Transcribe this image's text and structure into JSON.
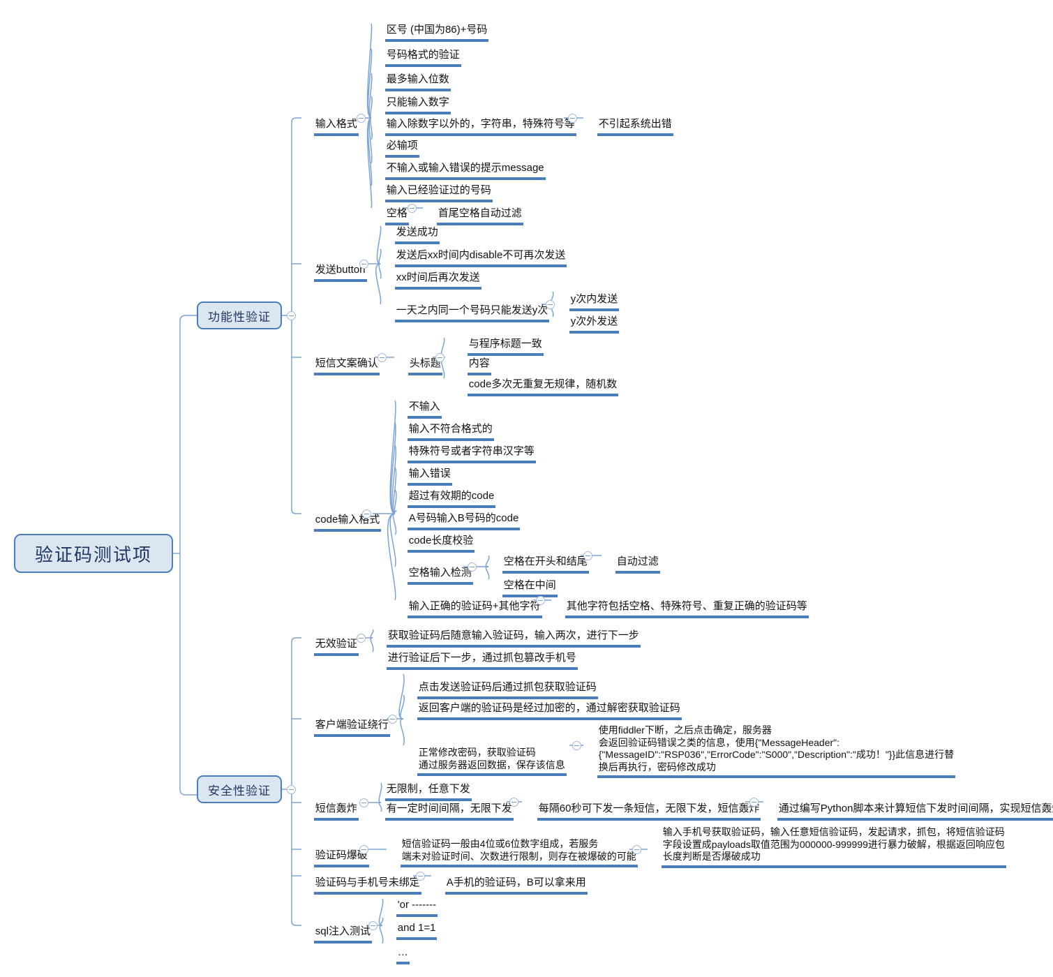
{
  "theme": {
    "accent": "#4a7ebb",
    "node_fill": "#dce6f1",
    "node_text": "#1f3864",
    "body_text": "#111111",
    "background": "#ffffff",
    "toggle_border": "#9db8dc"
  },
  "map": {
    "title": "验证码测试项",
    "type": "mindmap",
    "root": {
      "label": "验证码测试项",
      "children": [
        {
          "label": "功能性验证",
          "children": [
            {
              "label": "输入格式",
              "children": [
                {
                  "label": "区号 (中国为86)+号码"
                },
                {
                  "label": "号码格式的验证"
                },
                {
                  "label": "最多输入位数"
                },
                {
                  "label": "只能输入数字"
                },
                {
                  "label": "输入除数字以外的，字符串，特殊符号等",
                  "children": [
                    {
                      "label": "不引起系统出错"
                    }
                  ]
                },
                {
                  "label": "必输项"
                },
                {
                  "label": "不输入或输入错误的提示message"
                },
                {
                  "label": "输入已经验证过的号码"
                },
                {
                  "label": "空格",
                  "children": [
                    {
                      "label": "首尾空格自动过滤"
                    }
                  ]
                }
              ]
            },
            {
              "label": "发送button",
              "children": [
                {
                  "label": "发送成功"
                },
                {
                  "label": "发送后xx时间内disable不可再次发送"
                },
                {
                  "label": "xx时间后再次发送"
                },
                {
                  "label": "一天之内同一个号码只能发送y次",
                  "children": [
                    {
                      "label": "y次内发送"
                    },
                    {
                      "label": "y次外发送"
                    }
                  ]
                }
              ]
            },
            {
              "label": "短信文案确认",
              "children": [
                {
                  "label": "头标题",
                  "children": [
                    {
                      "label": "与程序标题一致"
                    },
                    {
                      "label": "内容"
                    },
                    {
                      "label": "code多次无重复无规律，随机数"
                    }
                  ]
                }
              ]
            },
            {
              "label": "code输入格式",
              "children": [
                {
                  "label": "不输入"
                },
                {
                  "label": "输入不符合格式的"
                },
                {
                  "label": "特殊符号或者字符串汉字等"
                },
                {
                  "label": "输入错误"
                },
                {
                  "label": "超过有效期的code"
                },
                {
                  "label": "A号码输入B号码的code"
                },
                {
                  "label": "code长度校验"
                },
                {
                  "label": "空格输入检测",
                  "children": [
                    {
                      "label": "空格在开头和结尾",
                      "children": [
                        {
                          "label": "自动过滤"
                        }
                      ]
                    },
                    {
                      "label": "空格在中间"
                    }
                  ]
                },
                {
                  "label": "输入正确的验证码+其他字符",
                  "children": [
                    {
                      "label": "其他字符包括空格、特殊符号、重复正确的验证码等"
                    }
                  ]
                }
              ]
            }
          ]
        },
        {
          "label": "安全性验证",
          "children": [
            {
              "label": "无效验证",
              "children": [
                {
                  "label": "获取验证码后随意输入验证码，输入两次，进行下一步"
                },
                {
                  "label": "进行验证后下一步，通过抓包篡改手机号"
                }
              ]
            },
            {
              "label": "客户端验证绕行",
              "children": [
                {
                  "label": "点击发送验证码后通过抓包获取验证码"
                },
                {
                  "label": "返回客户端的验证码是经过加密的，通过解密获取验证码"
                },
                {
                  "label": "正常修改密码，获取验证码\n通过服务器返回数据，保存该信息",
                  "children": [
                    {
                      "label": "使用fiddler下断，之后点击确定，服务器\n会返回验证码错误之类的信息，使用{\"MessageHeader\":\n{\"MessageID\":\"RSP036\",\"ErrorCode\":\"S000\",\"Description\":\"成功！\"}}此信息进行替\n换后再执行，密码修改成功"
                    }
                  ]
                }
              ]
            },
            {
              "label": "短信轰炸",
              "children": [
                {
                  "label": "无限制，任意下发"
                },
                {
                  "label": "有一定时间间隔，无限下发",
                  "children": [
                    {
                      "label": "每隔60秒可下发一条短信，无限下发，短信轰炸",
                      "children": [
                        {
                          "label": "通过编写Python脚本来计算短信下发时间间隔，实现短信轰炸"
                        }
                      ]
                    }
                  ]
                }
              ]
            },
            {
              "label": "验证码爆破",
              "children": [
                {
                  "label": "短信验证码一般由4位或6位数字组成，若服务\n端未对验证时间、次数进行限制，则存在被爆破的可能",
                  "children": [
                    {
                      "label": "输入手机号获取验证码，输入任意短信验证码，发起请求，抓包，将短信验证码\n字段设置成payloads取值范围为000000-999999进行暴力破解，根据返回响应包\n长度判断是否爆破成功"
                    }
                  ]
                }
              ]
            },
            {
              "label": "验证码与手机号未绑定",
              "children": [
                {
                  "label": "A手机的验证码，B可以拿来用"
                }
              ]
            },
            {
              "label": "sql注入测试",
              "children": [
                {
                  "label": "'or -------"
                },
                {
                  "label": "and 1=1"
                },
                {
                  "label": "…"
                }
              ]
            }
          ]
        }
      ]
    }
  },
  "nodes": {
    "root": "验证码测试项",
    "b1": "功能性验证",
    "b2": "安全性验证",
    "n_input_format": "输入格式",
    "n_if_1": "区号 (中国为86)+号码",
    "n_if_2": "号码格式的验证",
    "n_if_3": "最多输入位数",
    "n_if_4": "只能输入数字",
    "n_if_5": "输入除数字以外的，字符串，特殊符号等",
    "n_if_5_1": "不引起系统出错",
    "n_if_6": "必输项",
    "n_if_7": "不输入或输入错误的提示message",
    "n_if_8": "输入已经验证过的号码",
    "n_if_9": "空格",
    "n_if_9_1": "首尾空格自动过滤",
    "n_send_btn": "发送button",
    "n_sb_1": "发送成功",
    "n_sb_2": "发送后xx时间内disable不可再次发送",
    "n_sb_3": "xx时间后再次发送",
    "n_sb_4": "一天之内同一个号码只能发送y次",
    "n_sb_4_1": "y次内发送",
    "n_sb_4_2": "y次外发送",
    "n_sms_text": "短信文案确认",
    "n_st_1": "头标题",
    "n_st_1_1": "与程序标题一致",
    "n_st_1_2": "内容",
    "n_st_1_3": "code多次无重复无规律，随机数",
    "n_code_format": "code输入格式",
    "n_cf_1": "不输入",
    "n_cf_2": "输入不符合格式的",
    "n_cf_3": "特殊符号或者字符串汉字等",
    "n_cf_4": "输入错误",
    "n_cf_5": "超过有效期的code",
    "n_cf_6": "A号码输入B号码的code",
    "n_cf_7": "code长度校验",
    "n_cf_8": "空格输入检测",
    "n_cf_8_1": "空格在开头和结尾",
    "n_cf_8_1_1": "自动过滤",
    "n_cf_8_2": "空格在中间",
    "n_cf_9": "输入正确的验证码+其他字符",
    "n_cf_9_1": "其他字符包括空格、特殊符号、重复正确的验证码等",
    "n_invalid": "无效验证",
    "n_iv_1": "获取验证码后随意输入验证码，输入两次，进行下一步",
    "n_iv_2": "进行验证后下一步，通过抓包篡改手机号",
    "n_bypass": "客户端验证绕行",
    "n_bp_1": "点击发送验证码后通过抓包获取验证码",
    "n_bp_2": "返回客户端的验证码是经过加密的，通过解密获取验证码",
    "n_bp_3": "正常修改密码，获取验证码\n通过服务器返回数据，保存该信息",
    "n_bp_3_1": "使用fiddler下断，之后点击确定，服务器\n会返回验证码错误之类的信息，使用{\"MessageHeader\":\n{\"MessageID\":\"RSP036\",\"ErrorCode\":\"S000\",\"Description\":\"成功！\"}}此信息进行替\n换后再执行，密码修改成功",
    "n_bomb": "短信轰炸",
    "n_bm_1": "无限制，任意下发",
    "n_bm_2": "有一定时间间隔，无限下发",
    "n_bm_2_1": "每隔60秒可下发一条短信，无限下发，短信轰炸",
    "n_bm_2_1_1": "通过编写Python脚本来计算短信下发时间间隔，实现短信轰炸",
    "n_brute": "验证码爆破",
    "n_br_1": "短信验证码一般由4位或6位数字组成，若服务\n端未对验证时间、次数进行限制，则存在被爆破的可能",
    "n_br_1_1": "输入手机号获取验证码，输入任意短信验证码，发起请求，抓包，将短信验证码\n字段设置成payloads取值范围为000000-999999进行暴力破解，根据返回响应包\n长度判断是否爆破成功",
    "n_unbound": "验证码与手机号未绑定",
    "n_ub_1": "A手机的验证码，B可以拿来用",
    "n_sqli": "sql注入测试",
    "n_sq_1": "'or -------",
    "n_sq_2": "and 1=1",
    "n_sq_3": "…"
  }
}
